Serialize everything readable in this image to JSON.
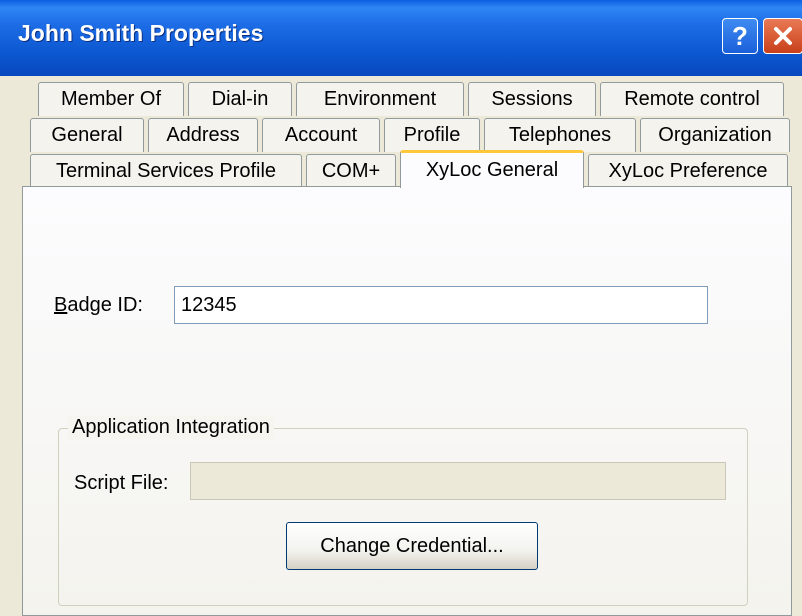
{
  "window": {
    "title": "John Smith Properties",
    "help_glyph": "?",
    "icons": {
      "help": "help-icon",
      "close": "close-icon"
    }
  },
  "tabs": {
    "row1": [
      "Member Of",
      "Dial-in",
      "Environment",
      "Sessions",
      "Remote control"
    ],
    "row2": [
      "General",
      "Address",
      "Account",
      "Profile",
      "Telephones",
      "Organization"
    ],
    "row3": [
      "Terminal Services Profile",
      "COM+",
      "XyLoc General",
      "XyLoc Preference"
    ],
    "active": "XyLoc General"
  },
  "form": {
    "badge_label_mnemonic": "B",
    "badge_label_rest": "adge ID:",
    "badge_value": "12345",
    "group_title": "Application Integration",
    "script_label": "Script File:",
    "script_value": "",
    "change_credential_label": "Change Credential..."
  },
  "colors": {
    "titlebar": "#0B57D0",
    "dialog_bg": "#ECE9D8",
    "active_tab_highlight": "#FFC83C",
    "close_button": "#D9542B"
  }
}
